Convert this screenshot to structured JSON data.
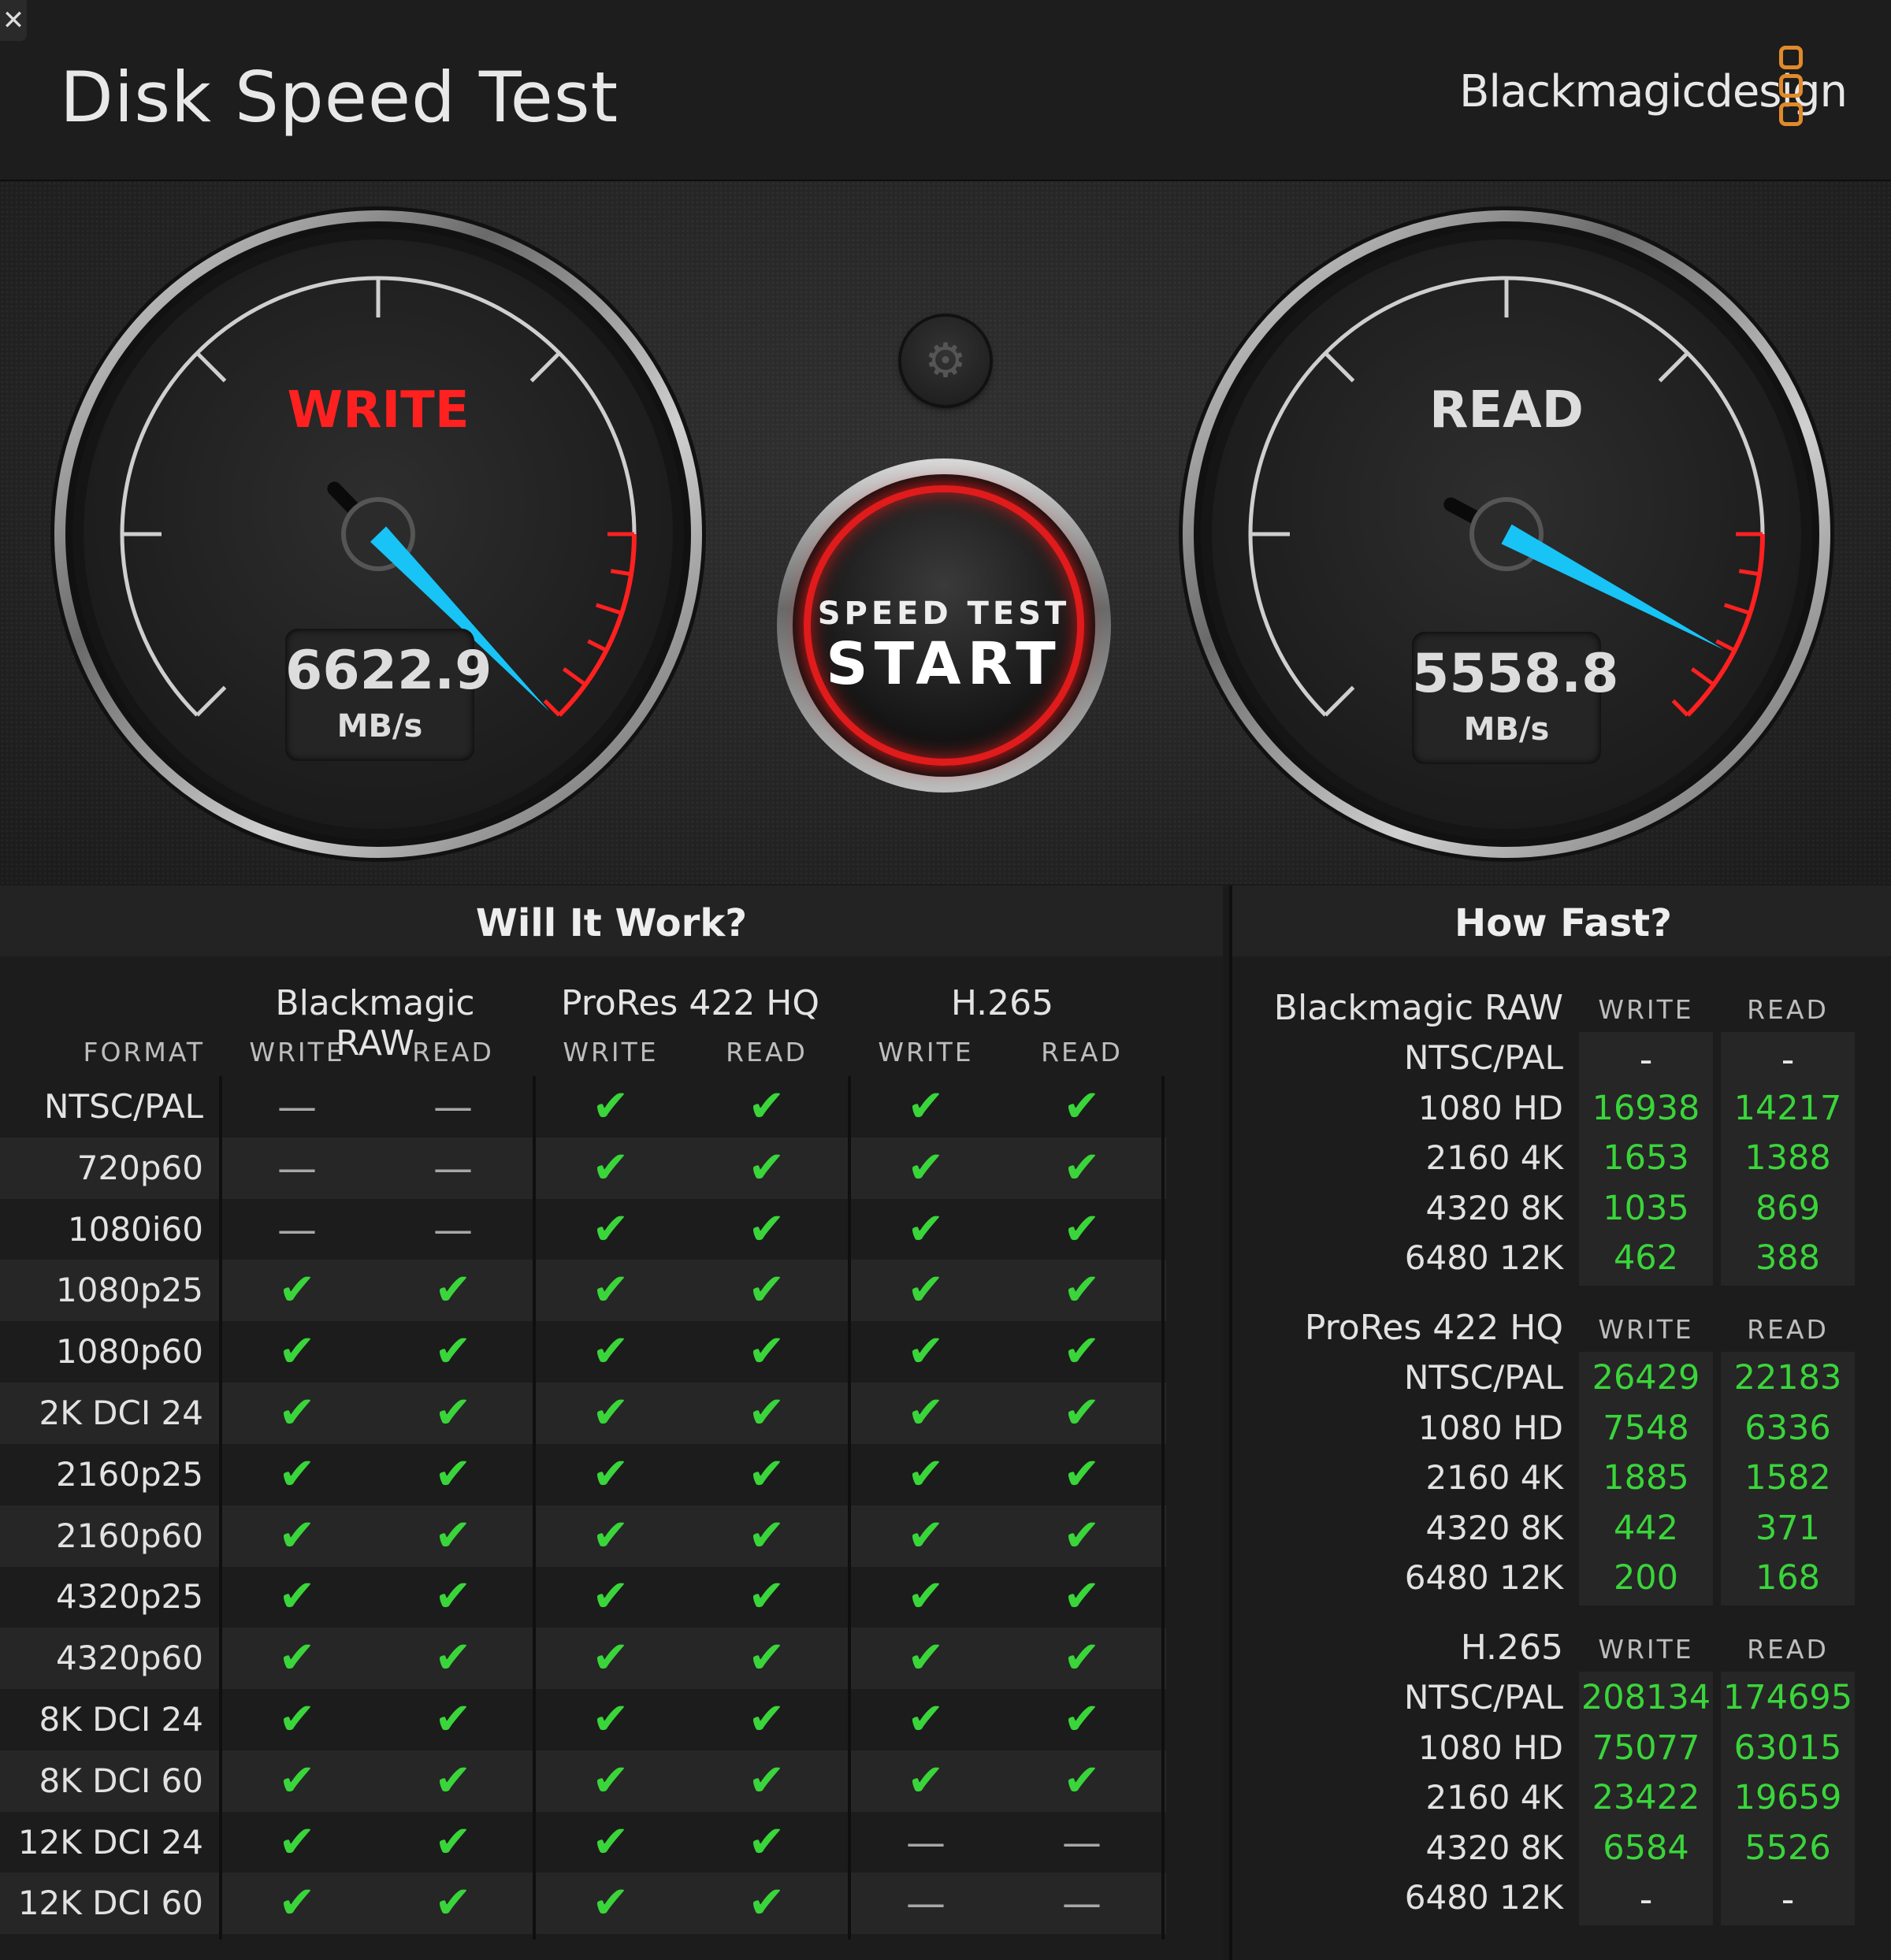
{
  "app": {
    "title": "Disk Speed Test",
    "brand": "Blackmagicdesign",
    "close": "✕"
  },
  "gauges": {
    "write": {
      "label": "WRITE",
      "value": "6622.9",
      "unit": "MB/s",
      "color": "#ff2020"
    },
    "read": {
      "label": "READ",
      "value": "5558.8",
      "unit": "MB/s",
      "color": "#dddddd"
    }
  },
  "start_button": {
    "line1": "SPEED TEST",
    "line2": "START"
  },
  "settings": {
    "icon": "gear-icon"
  },
  "will_it_work": {
    "title": "Will It Work?",
    "format_header": "FORMAT",
    "codecs": [
      "Blackmagic RAW",
      "ProRes 422 HQ",
      "H.265"
    ],
    "subheaders": [
      "WRITE",
      "READ",
      "WRITE",
      "READ",
      "WRITE",
      "READ"
    ],
    "rows": [
      {
        "format": "NTSC/PAL",
        "cells": [
          "-",
          "-",
          "ok",
          "ok",
          "ok",
          "ok"
        ]
      },
      {
        "format": "720p60",
        "cells": [
          "-",
          "-",
          "ok",
          "ok",
          "ok",
          "ok"
        ]
      },
      {
        "format": "1080i60",
        "cells": [
          "-",
          "-",
          "ok",
          "ok",
          "ok",
          "ok"
        ]
      },
      {
        "format": "1080p25",
        "cells": [
          "ok",
          "ok",
          "ok",
          "ok",
          "ok",
          "ok"
        ]
      },
      {
        "format": "1080p60",
        "cells": [
          "ok",
          "ok",
          "ok",
          "ok",
          "ok",
          "ok"
        ]
      },
      {
        "format": "2K DCI 24",
        "cells": [
          "ok",
          "ok",
          "ok",
          "ok",
          "ok",
          "ok"
        ]
      },
      {
        "format": "2160p25",
        "cells": [
          "ok",
          "ok",
          "ok",
          "ok",
          "ok",
          "ok"
        ]
      },
      {
        "format": "2160p60",
        "cells": [
          "ok",
          "ok",
          "ok",
          "ok",
          "ok",
          "ok"
        ]
      },
      {
        "format": "4320p25",
        "cells": [
          "ok",
          "ok",
          "ok",
          "ok",
          "ok",
          "ok"
        ]
      },
      {
        "format": "4320p60",
        "cells": [
          "ok",
          "ok",
          "ok",
          "ok",
          "ok",
          "ok"
        ]
      },
      {
        "format": "8K DCI 24",
        "cells": [
          "ok",
          "ok",
          "ok",
          "ok",
          "ok",
          "ok"
        ]
      },
      {
        "format": "8K DCI 60",
        "cells": [
          "ok",
          "ok",
          "ok",
          "ok",
          "ok",
          "ok"
        ]
      },
      {
        "format": "12K DCI 24",
        "cells": [
          "ok",
          "ok",
          "ok",
          "ok",
          "-",
          "-"
        ]
      },
      {
        "format": "12K DCI 60",
        "cells": [
          "ok",
          "ok",
          "ok",
          "ok",
          "-",
          "-"
        ]
      }
    ]
  },
  "how_fast": {
    "title": "How Fast?",
    "groups": [
      {
        "codec": "Blackmagic RAW",
        "write_label": "WRITE",
        "read_label": "READ",
        "rows": [
          {
            "format": "NTSC/PAL",
            "write": "-",
            "read": "-"
          },
          {
            "format": "1080 HD",
            "write": "16938",
            "read": "14217"
          },
          {
            "format": "2160 4K",
            "write": "1653",
            "read": "1388"
          },
          {
            "format": "4320 8K",
            "write": "1035",
            "read": "869"
          },
          {
            "format": "6480 12K",
            "write": "462",
            "read": "388"
          }
        ]
      },
      {
        "codec": "ProRes 422 HQ",
        "write_label": "WRITE",
        "read_label": "READ",
        "rows": [
          {
            "format": "NTSC/PAL",
            "write": "26429",
            "read": "22183"
          },
          {
            "format": "1080 HD",
            "write": "7548",
            "read": "6336"
          },
          {
            "format": "2160 4K",
            "write": "1885",
            "read": "1582"
          },
          {
            "format": "4320 8K",
            "write": "442",
            "read": "371"
          },
          {
            "format": "6480 12K",
            "write": "200",
            "read": "168"
          }
        ]
      },
      {
        "codec": "H.265",
        "write_label": "WRITE",
        "read_label": "READ",
        "rows": [
          {
            "format": "NTSC/PAL",
            "write": "208134",
            "read": "174695"
          },
          {
            "format": "1080 HD",
            "write": "75077",
            "read": "63015"
          },
          {
            "format": "2160 4K",
            "write": "23422",
            "read": "19659"
          },
          {
            "format": "4320 8K",
            "write": "6584",
            "read": "5526"
          },
          {
            "format": "6480 12K",
            "write": "-",
            "read": "-"
          }
        ]
      }
    ]
  },
  "colors": {
    "accent_green": "#3ad53a",
    "brand_orange": "#e08a2a",
    "needle": "#18c3f5",
    "redline": "#ff2020"
  }
}
